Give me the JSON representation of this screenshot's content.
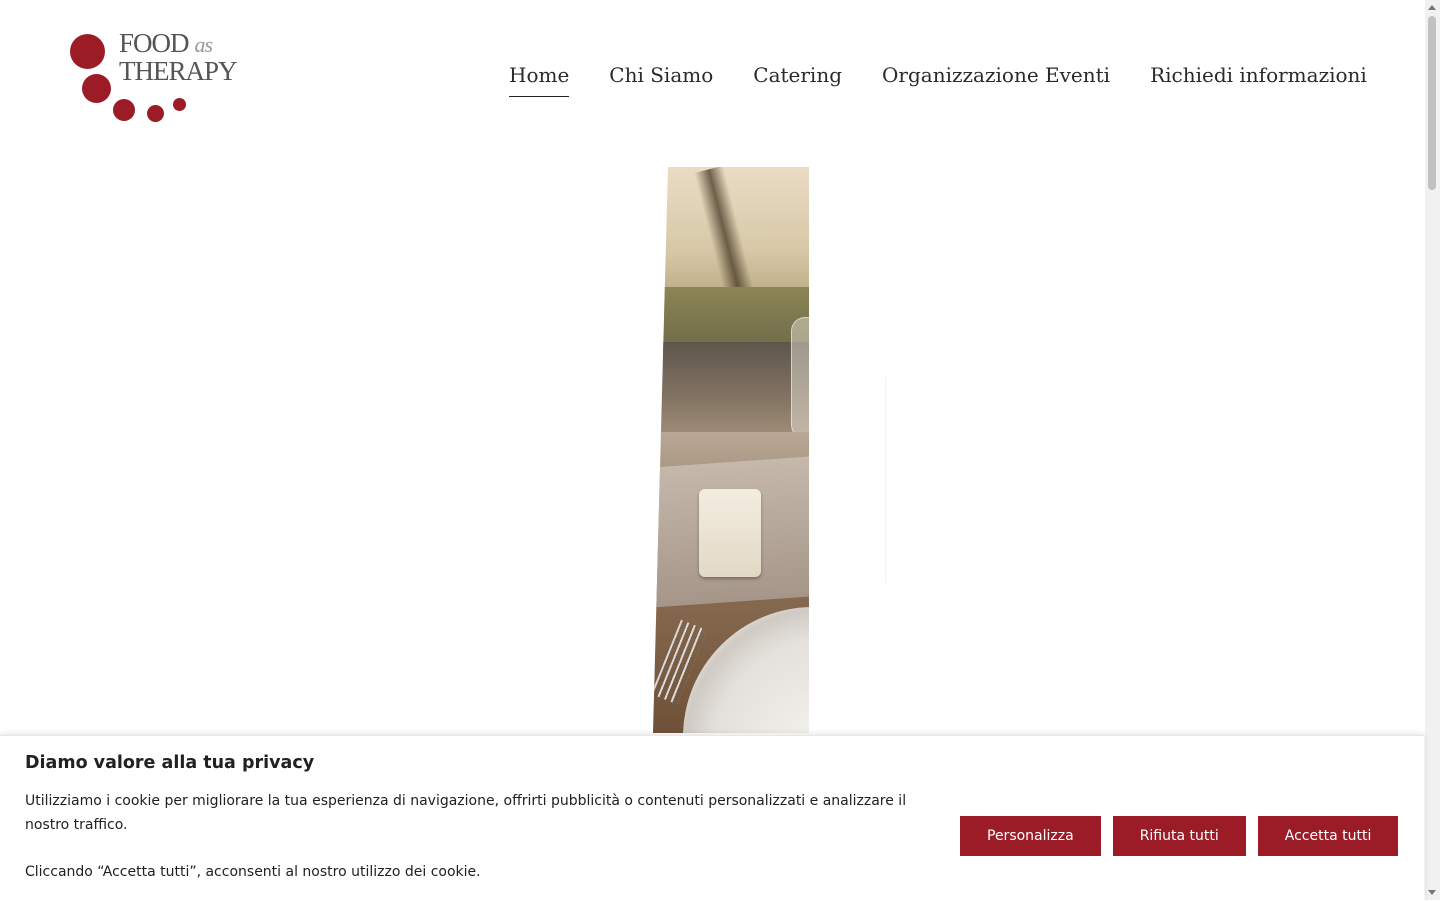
{
  "brand": {
    "line1": "FOOD",
    "script": "as",
    "line2": "THERAPY",
    "color": "#9b1c27"
  },
  "nav": {
    "items": [
      {
        "label": "Home",
        "active": true
      },
      {
        "label": "Chi Siamo",
        "active": false
      },
      {
        "label": "Catering",
        "active": false
      },
      {
        "label": "Organizzazione Eventi",
        "active": false
      },
      {
        "label": "Richiedi informazioni",
        "active": false
      }
    ]
  },
  "cookie_banner": {
    "title": "Diamo valore alla tua privacy",
    "description": "Utilizziamo i cookie per migliorare la tua esperienza di navigazione, offrirti pubblicità o contenuti personalizzati e analizzare il nostro traffico.",
    "consent_note": "Cliccando “Accetta tutti”, acconsenti al nostro utilizzo dei cookie.",
    "buttons": {
      "customize": "Personalizza",
      "reject": "Rifiuta tutti",
      "accept": "Accetta tutti"
    },
    "button_color": "#9b1c27"
  }
}
